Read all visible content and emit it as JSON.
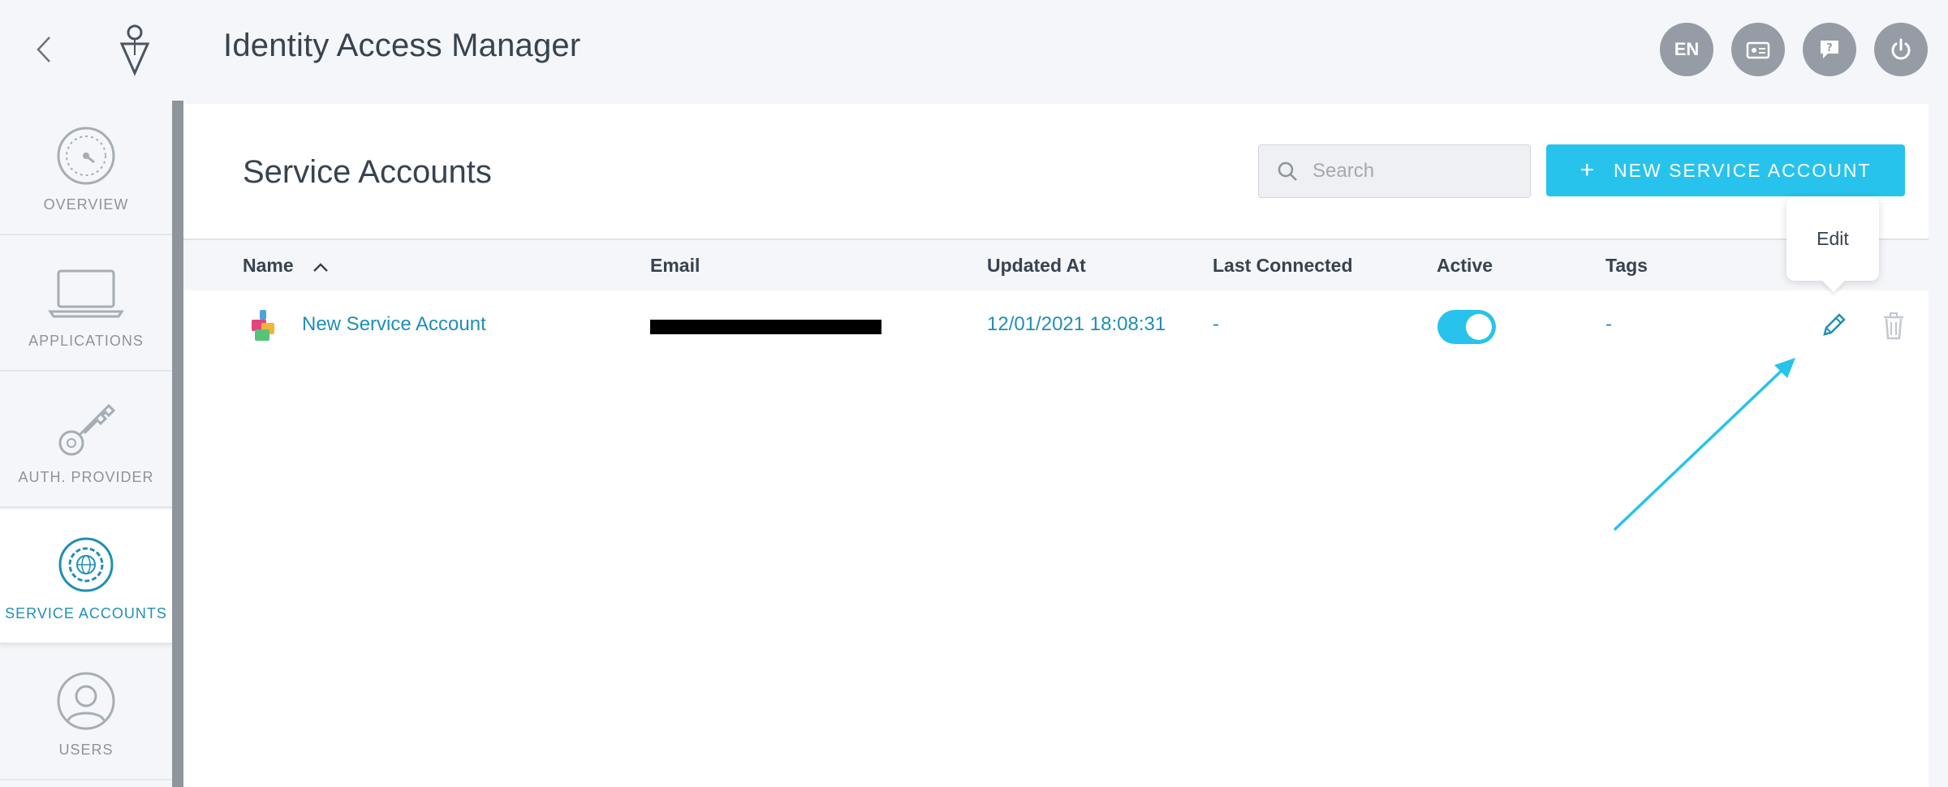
{
  "header": {
    "title": "Identity Access Manager",
    "language": "EN"
  },
  "sidebar": {
    "items": [
      {
        "label": "OVERVIEW",
        "icon": "dashboard-gauge-icon"
      },
      {
        "label": "APPLICATIONS",
        "icon": "laptop-icon"
      },
      {
        "label": "AUTH. PROVIDER",
        "icon": "key-icon"
      },
      {
        "label": "SERVICE ACCOUNTS",
        "icon": "gear-globe-icon",
        "active": true
      },
      {
        "label": "USERS",
        "icon": "user-avatar-icon"
      }
    ]
  },
  "page": {
    "title": "Service Accounts",
    "search_placeholder": "Search",
    "new_button_label": "NEW SERVICE ACCOUNT"
  },
  "table": {
    "columns": [
      "Name",
      "Email",
      "Updated At",
      "Last Connected",
      "Active",
      "Tags"
    ],
    "rows": [
      {
        "name": "New Service Account",
        "updated_at": "12/01/2021 18:08:31",
        "last_connected": "-",
        "active": true,
        "tags": "-"
      }
    ]
  },
  "tooltip": {
    "text": "Edit"
  },
  "colors": {
    "accent": "#27c3ec",
    "link": "#1f8fb5",
    "annotation_arrow": "#27c3ec"
  }
}
